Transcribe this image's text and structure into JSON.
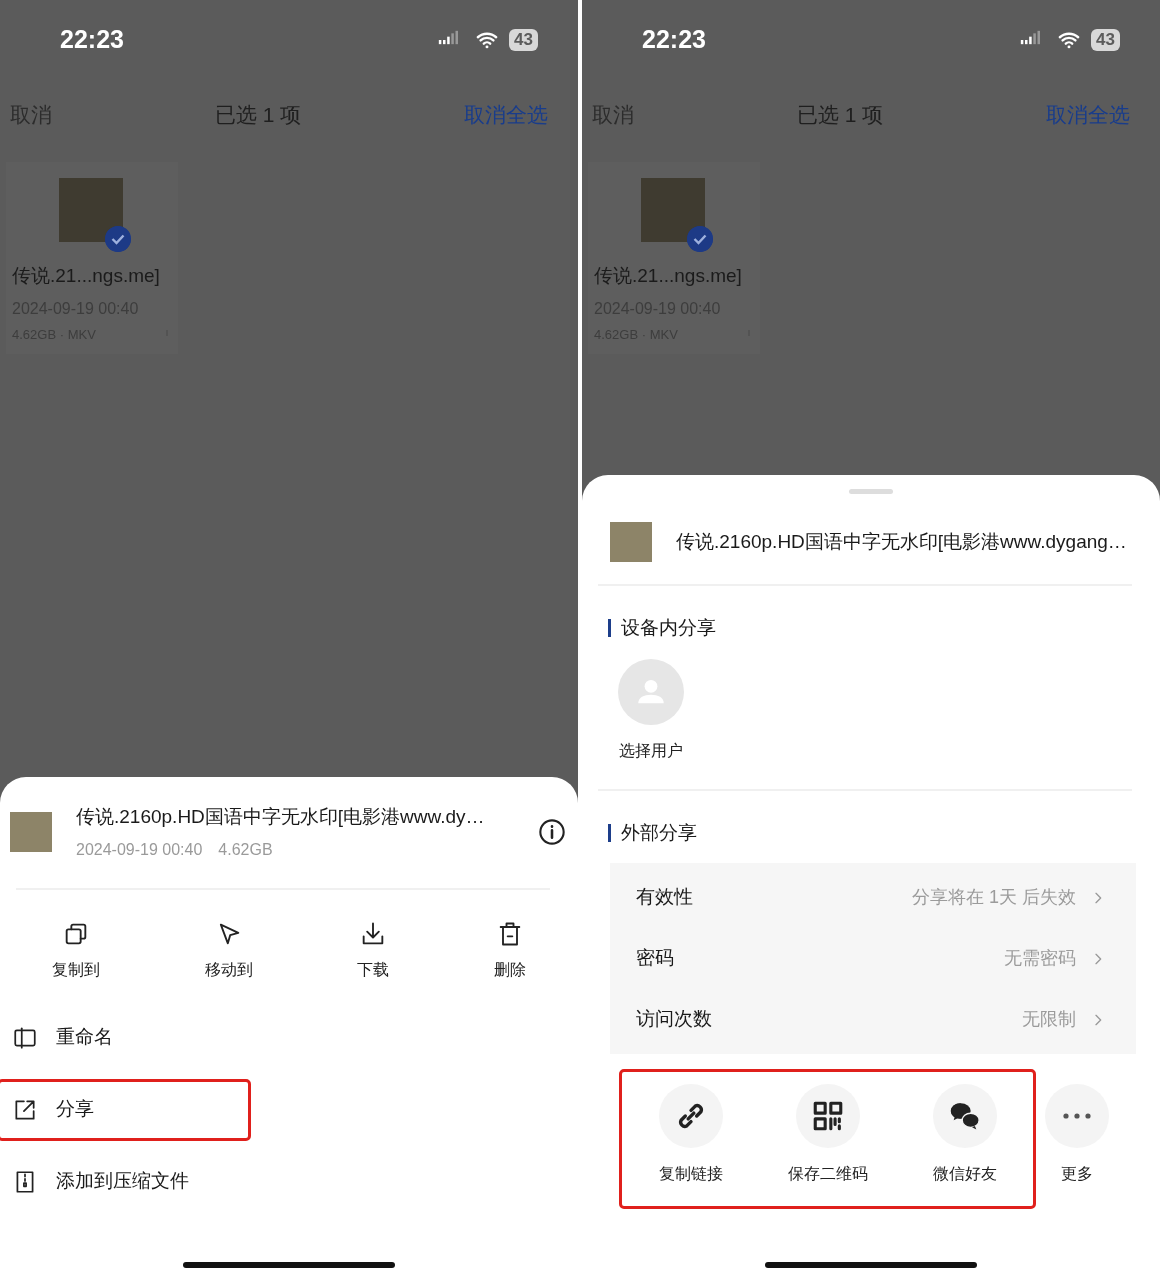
{
  "screens": [
    {
      "status_bar": {
        "time": "22:23",
        "battery": "43"
      },
      "nav": {
        "cancel": "取消",
        "title": "已选 1 项",
        "select_all": "取消全选"
      },
      "files": [
        {
          "name": "传说.21...ngs.me]",
          "date": "2024-09-19 00:40",
          "meta": "4.62GB · MKV",
          "selected": true
        }
      ],
      "sheet": {
        "kind": "actions",
        "file": {
          "name": "传说.2160p.HD国语中字无水印[电影港www.dy…",
          "date": "2024-09-19 00:40",
          "size": "4.62GB"
        },
        "actions": [
          {
            "label": "复制到"
          },
          {
            "label": "移动到"
          },
          {
            "label": "下载"
          },
          {
            "label": "删除"
          }
        ],
        "menu": [
          {
            "label": "重命名",
            "highlighted": false
          },
          {
            "label": "分享",
            "highlighted": true
          },
          {
            "label": "添加到压缩文件",
            "highlighted": false
          }
        ]
      }
    },
    {
      "status_bar": {
        "time": "22:23",
        "battery": "43"
      },
      "nav": {
        "cancel": "取消",
        "title": "已选 1 项",
        "select_all": "取消全选"
      },
      "files": [
        {
          "name": "传说.21...ngs.me]",
          "date": "2024-09-19 00:40",
          "meta": "4.62GB · MKV",
          "selected": true
        }
      ],
      "sheet": {
        "kind": "share",
        "file": {
          "name": "传说.2160p.HD国语中字无水印[电影港www.dygang…"
        },
        "in_device_title": "设备内分享",
        "users": [
          {
            "label": "选择用户"
          }
        ],
        "external_title": "外部分享",
        "settings": [
          {
            "label": "有效性",
            "value": "分享将在 1天 后失效"
          },
          {
            "label": "密码",
            "value": "无需密码"
          },
          {
            "label": "访问次数",
            "value": "无限制"
          }
        ],
        "targets": [
          {
            "label": "复制链接",
            "highlighted": true
          },
          {
            "label": "保存二维码",
            "highlighted": true
          },
          {
            "label": "微信好友",
            "highlighted": true
          },
          {
            "label": "更多",
            "highlighted": false
          }
        ]
      }
    }
  ]
}
